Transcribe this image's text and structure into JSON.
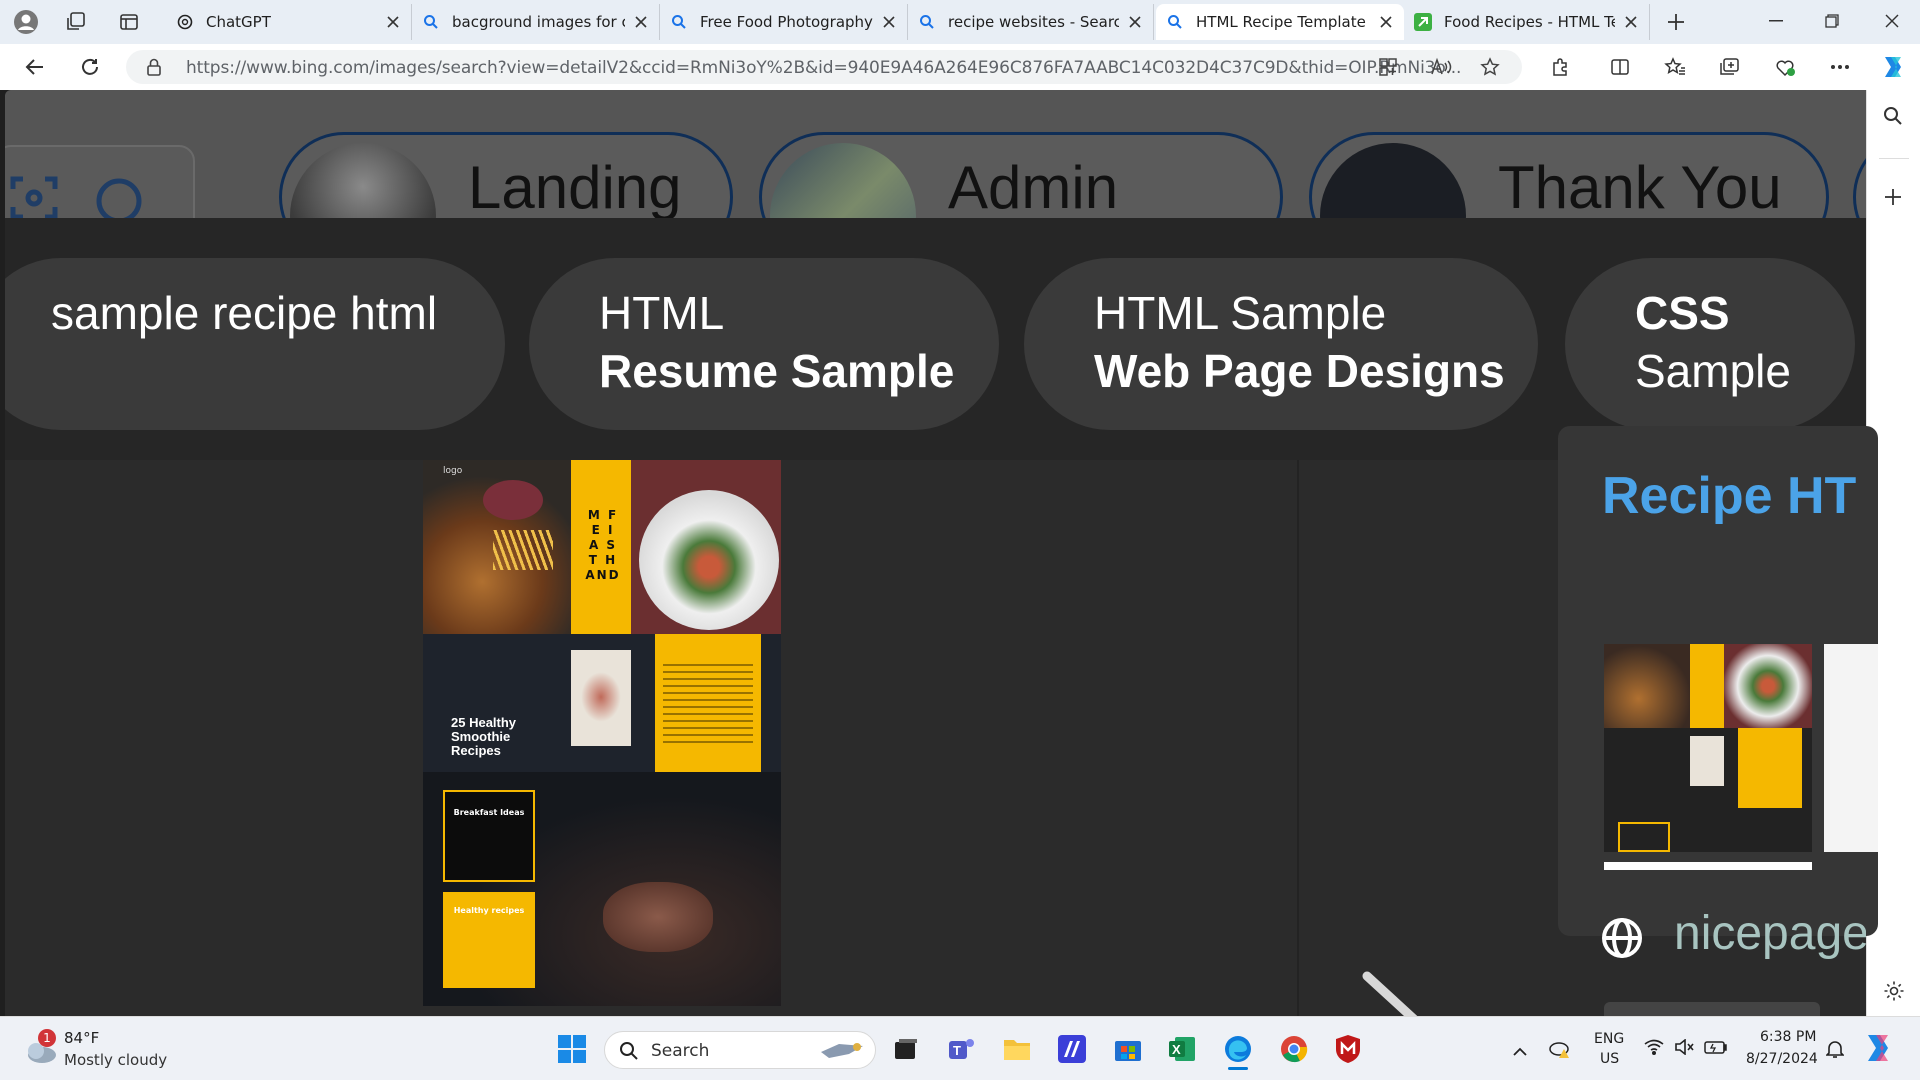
{
  "browser": {
    "tabs": [
      {
        "label": "ChatGPT",
        "favicon": "openai-icon",
        "active": false
      },
      {
        "label": "bacground images for coo",
        "favicon": "bing-search-icon",
        "active": false
      },
      {
        "label": "Free Food Photography -",
        "favicon": "bing-search-icon",
        "active": false
      },
      {
        "label": "recipe websites - Search",
        "favicon": "bing-search-icon",
        "active": false
      },
      {
        "label": "HTML Recipe Template - S",
        "favicon": "bing-search-icon",
        "active": true
      },
      {
        "label": "Food Recipes - HTML Tem",
        "favicon": "leaf-icon",
        "active": false
      }
    ],
    "url": "https://www.bing.com/images/search?view=detailV2&ccid=RmNi3oY%2B&id=940E9A46A264E96C876FA7AABC14C032D4C37C9D&thid=OIP.RmNi3o..."
  },
  "top_strip": {
    "pills": [
      {
        "label": "Landing"
      },
      {
        "label": "Admin"
      },
      {
        "label": "Thank You"
      }
    ]
  },
  "related_searches": [
    {
      "line1": "sample recipe html",
      "line2": ""
    },
    {
      "line1": "HTML",
      "line2": "Resume Sample"
    },
    {
      "line1": "HTML Sample",
      "line2": "Web Page Designs"
    },
    {
      "line1": "CSS",
      "line2": "Sample"
    }
  ],
  "main_image": {
    "logo_text": "logo",
    "title_letters": "M F\nE I\nA S\nT H\nAND",
    "heading": "25 Healthy\nSmoothie\nRecipes",
    "box1_title": "Breakfast Ideas",
    "box2_title": "Healthy recipes"
  },
  "side_panel": {
    "title": "Recipe HT",
    "source": "nicepage"
  },
  "taskbar": {
    "weather_temp": "84°F",
    "weather_desc": "Mostly cloudy",
    "weather_badge": "1",
    "search_placeholder": "Search",
    "lang_line1": "ENG",
    "lang_line2": "US",
    "time": "6:38 PM",
    "date": "8/27/2024"
  },
  "colors": {
    "accent_yellow": "#f5b800",
    "link_blue": "#4ba3e8",
    "pill_border": "#0f2e57"
  }
}
